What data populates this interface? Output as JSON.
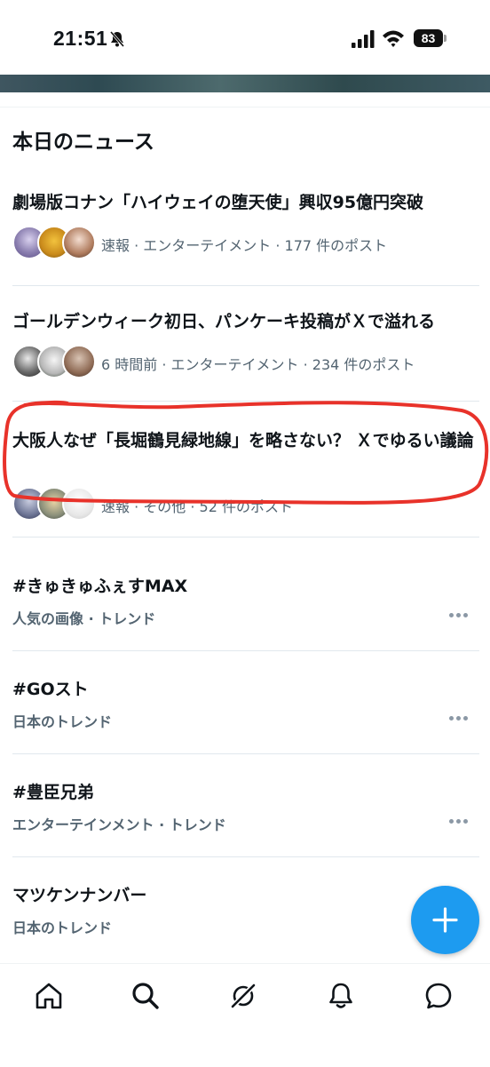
{
  "status_bar": {
    "time": "21:51",
    "battery": "83"
  },
  "section_title": "本日のニュース",
  "news": [
    {
      "headline": "劇場版コナン「ハイウェイの堕天使」興収95億円突破",
      "meta": "速報 · エンターテイメント · 177 件のポスト"
    },
    {
      "headline": "ゴールデンウィーク初日、パンケーキ投稿がＸで溢れる",
      "meta": "6 時間前 · エンターテイメント · 234 件のポスト"
    },
    {
      "headline": "大阪人なぜ「長堀鶴見緑地線」を略さない？ Ｘでゆるい議論",
      "meta": "速報 · その他 · 52 件のポスト"
    }
  ],
  "trends": [
    {
      "title": "#きゅきゅふぇすMAX",
      "sub": "人気の画像 · トレンド"
    },
    {
      "title": "#GOスト",
      "sub": "日本のトレンド"
    },
    {
      "title": "#豊臣兄弟",
      "sub": "エンターテインメント · トレンド"
    },
    {
      "title": "マツケンナンバー",
      "sub": "日本のトレンド"
    }
  ],
  "icons": {
    "status": [
      "bell-off-icon",
      "signal-icon",
      "wifi-icon",
      "battery-icon"
    ],
    "tabs": [
      "home-icon",
      "search-icon",
      "grok-icon",
      "notifications-icon",
      "messages-icon"
    ],
    "fab": "plus-icon",
    "trend_more": "more-icon"
  },
  "colors": {
    "accent": "#1d9bf0",
    "annotation": "#e8322a",
    "secondary_text": "#536471"
  }
}
